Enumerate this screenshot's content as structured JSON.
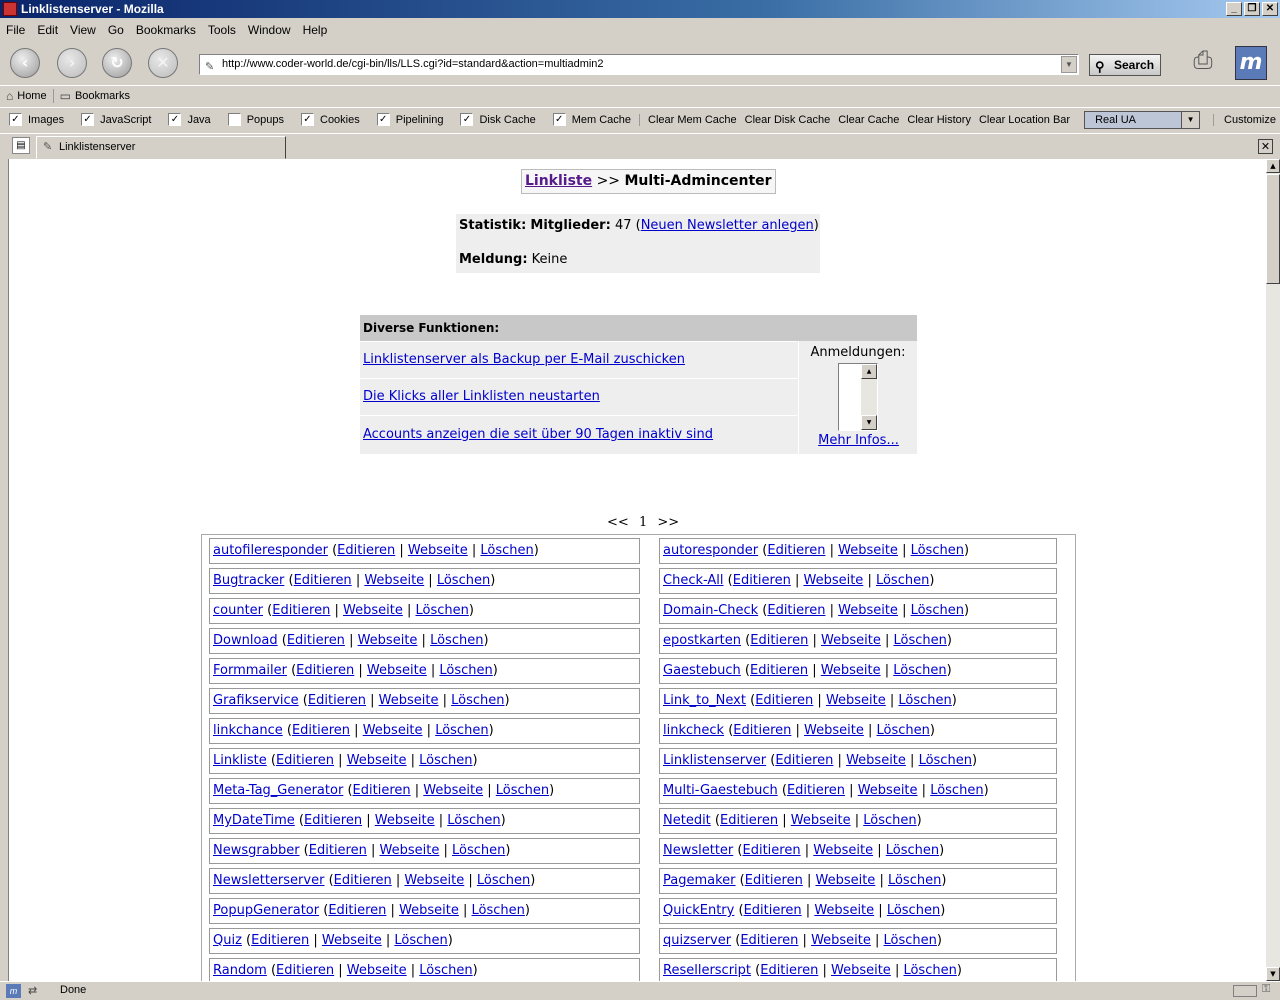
{
  "window": {
    "title": "Linklistenserver - Mozilla"
  },
  "menu": [
    "File",
    "Edit",
    "View",
    "Go",
    "Bookmarks",
    "Tools",
    "Window",
    "Help"
  ],
  "nav": {
    "url": "http://www.coder-world.de/cgi-bin/lls/LLS.cgi?id=standard&action=multiadmin2",
    "search_label": "Search"
  },
  "personal_bar": {
    "home": "Home",
    "bookmarks": "Bookmarks"
  },
  "prefbar": {
    "checkboxes": [
      {
        "label": "Images",
        "checked": true
      },
      {
        "label": "JavaScript",
        "checked": true
      },
      {
        "label": "Java",
        "checked": true
      },
      {
        "label": "Popups",
        "checked": false
      },
      {
        "label": "Cookies",
        "checked": true
      },
      {
        "label": "Pipelining",
        "checked": true
      },
      {
        "label": "Disk Cache",
        "checked": true
      },
      {
        "label": "Mem Cache",
        "checked": true
      }
    ],
    "buttons": [
      "Clear Mem Cache",
      "Clear Disk Cache",
      "Clear Cache",
      "Clear History",
      "Clear Location Bar"
    ],
    "ua_select": "Real UA",
    "customize": "Customize"
  },
  "tab": {
    "label": "Linklistenserver"
  },
  "page": {
    "crumb_link": "Linkliste",
    "crumb_sep": ">>",
    "crumb_current": "Multi-Admincenter",
    "stat_label": "Statistik:",
    "members_label": "Mitglieder:",
    "members_count": "47",
    "newsletter_link": "Neuen Newsletter anlegen",
    "message_label": "Meldung:",
    "message_value": "Keine",
    "functions_header": "Diverse Funktionen:",
    "functions": [
      "Linklistenserver als Backup per E-Mail zuschicken",
      "Die Klicks aller Linklisten neustarten",
      "Accounts anzeigen die seit über 90 Tagen inaktiv sind"
    ],
    "registrations_label": "Anmeldungen:",
    "more_info": "Mehr Infos...",
    "pager": {
      "prev": "<<",
      "current": "1",
      "next": ">>"
    },
    "action_labels": {
      "edit": "Editieren",
      "web": "Webseite",
      "delete": "Löschen"
    },
    "scripts_left": [
      "autofileresponder",
      "Bugtracker",
      "counter",
      "Download",
      "Formmailer",
      "Grafikservice",
      "linkchance",
      "Linkliste",
      "Meta-Tag_Generator",
      "MyDateTime",
      "Newsgrabber",
      "Newsletterserver",
      "PopupGenerator",
      "Quiz",
      "Random"
    ],
    "scripts_right": [
      "autoresponder",
      "Check-All",
      "Domain-Check",
      "epostkarten",
      "Gaestebuch",
      "Link_to_Next",
      "linkcheck",
      "Linklistenserver",
      "Multi-Gaestebuch",
      "Netedit",
      "Newsletter",
      "Pagemaker",
      "QuickEntry",
      "quizserver",
      "Resellerscript"
    ]
  },
  "status": {
    "text": "Done"
  }
}
